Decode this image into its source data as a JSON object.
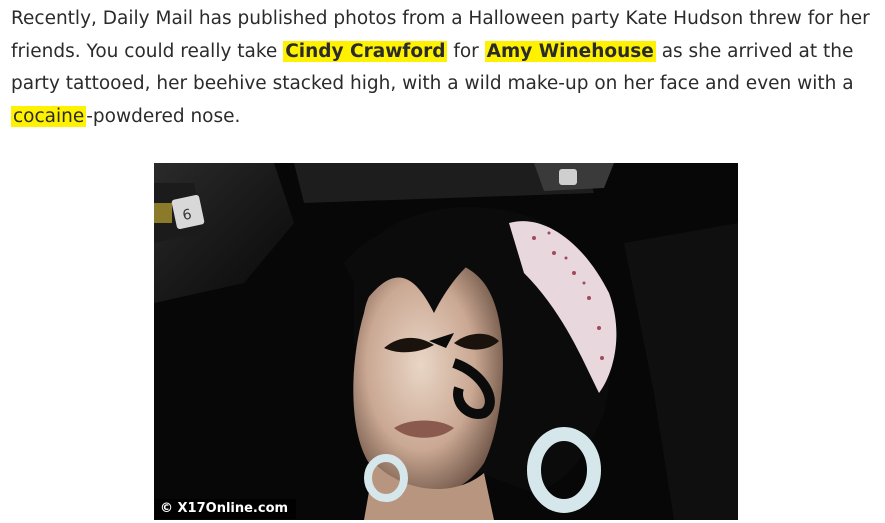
{
  "article": {
    "p1": "Recently, Daily Mail has published photos from a Halloween party Kate Hudson threw for her friends. You could really take ",
    "hl_cindy": "Cindy Crawford",
    "p2": " for ",
    "hl_amy": "Amy Winehouse",
    "p3": " as she arrived at the party tattooed, her beehive stacked high, with a wild make-up on her face and even with a ",
    "hl_cocaine": "cocaine",
    "p4": "-powdered nose."
  },
  "photo": {
    "watermark": "© X17Online.com"
  }
}
